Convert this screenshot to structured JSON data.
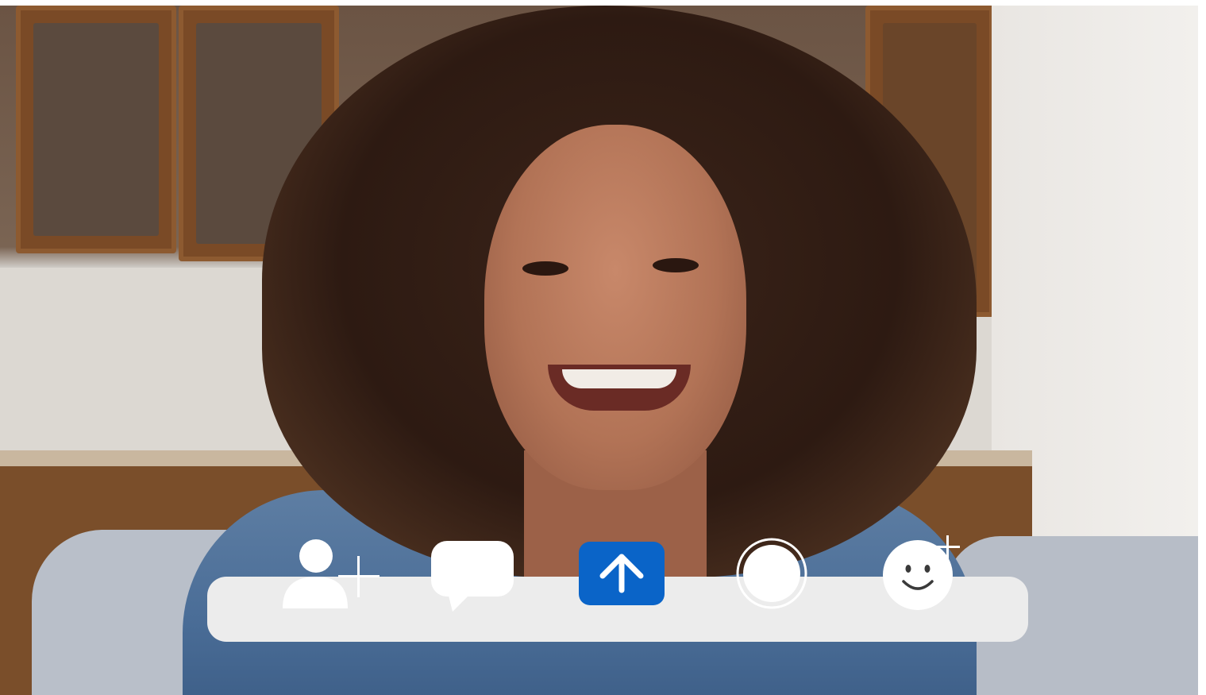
{
  "app": {
    "name": ""
  },
  "video": {
    "feed": "participant-camera"
  },
  "toolbar": {
    "buttons": [
      {
        "id": "add-person",
        "icon": "person-add-icon"
      },
      {
        "id": "chat",
        "icon": "speech-bubble-icon"
      },
      {
        "id": "share",
        "icon": "arrow-up-icon",
        "active": true
      },
      {
        "id": "record",
        "icon": "record-circle-icon"
      },
      {
        "id": "reactions",
        "icon": "emoji-add-icon"
      }
    ],
    "colors": {
      "bar": "#ececec",
      "accent": "#0a64c8",
      "icon": "#ffffff"
    }
  }
}
